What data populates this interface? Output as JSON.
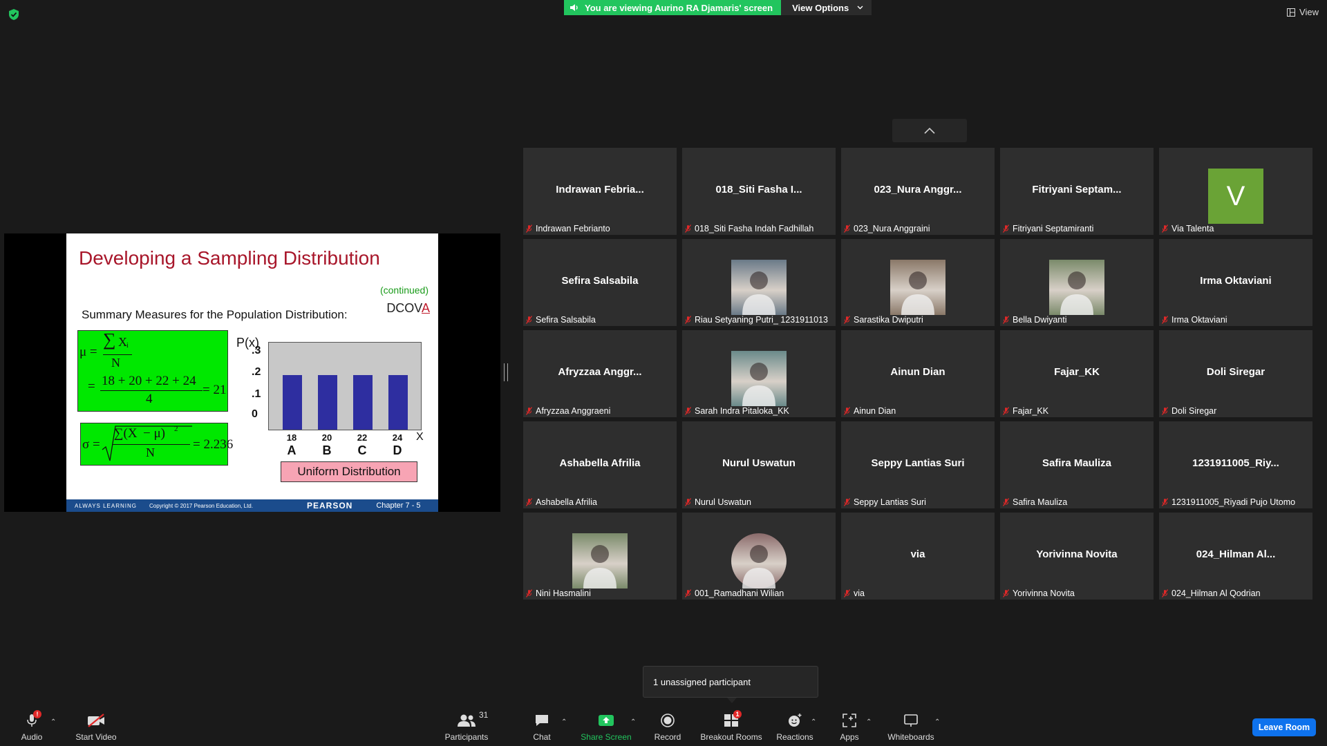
{
  "banner": {
    "viewing_text": "You are viewing Aurino RA Djamaris' screen",
    "view_options": "View Options"
  },
  "view_button": "View",
  "slide": {
    "title": "Developing a Sampling Distribution",
    "continued": "(continued)",
    "dcov": "DCOV",
    "dcova_a": "A",
    "subtitle": "Summary Measures for the Population Distribution:",
    "mu_symbol": "μ =",
    "sum_symbol": "∑",
    "xi": "X",
    "xi_sub": "i",
    "n": "N",
    "mu_expr": "18 + 20 + 22 + 24",
    "eq": "=",
    "mu_den": "4",
    "mu_result": "= 21",
    "sigma_symbol": "σ =",
    "sigma_num": "∑(X",
    "sigma_num_tail": " − μ)",
    "sigma_sq": "2",
    "sigma_result": "= 2.236",
    "px_label": "P(x)",
    "x_label": "X",
    "y_ticks": [
      ".3",
      ".2",
      ".1",
      "0"
    ],
    "x_values": [
      "18",
      "20",
      "22",
      "24"
    ],
    "x_letters": [
      "A",
      "B",
      "C",
      "D"
    ],
    "uniform_label": "Uniform Distribution",
    "footer_always": "ALWAYS LEARNING",
    "footer_copyright": "Copyright © 2017 Pearson Education, Ltd.",
    "footer_pearson": "PEARSON",
    "footer_chapter": "Chapter 7 - 5"
  },
  "chart_data": {
    "type": "bar",
    "categories": [
      "18",
      "20",
      "22",
      "24"
    ],
    "values": [
      0.25,
      0.25,
      0.25,
      0.25
    ],
    "ylabel": "P(x)",
    "xlabel": "X",
    "ylim": [
      0,
      0.4
    ]
  },
  "tiles": [
    {
      "center": "Indrawan  Febria...",
      "footer": "Indrawan Febrianto",
      "kind": "name"
    },
    {
      "center": "018_Siti Fasha I...",
      "footer": "018_Siti Fasha Indah Fadhillah",
      "kind": "name"
    },
    {
      "center": "023_Nura  Anggr...",
      "footer": "023_Nura Anggraini",
      "kind": "name"
    },
    {
      "center": "Fitriyani  Septam...",
      "footer": "Fitriyani Septamiranti",
      "kind": "name"
    },
    {
      "center": "V",
      "footer": "Via Talenta",
      "kind": "letter"
    },
    {
      "center": "Sefira Salsabila",
      "footer": "Sefira Salsabila",
      "kind": "name"
    },
    {
      "center": "",
      "footer": "Riau Setyaning Putri_ 1231911013",
      "kind": "photo"
    },
    {
      "center": "",
      "footer": "Sarastika Dwiputri",
      "kind": "photo"
    },
    {
      "center": "",
      "footer": "Bella Dwiyanti",
      "kind": "photo"
    },
    {
      "center": "Irma Oktaviani",
      "footer": "Irma Oktaviani",
      "kind": "name"
    },
    {
      "center": "Afryzzaa  Anggr...",
      "footer": "Afryzzaa Anggraeni",
      "kind": "name"
    },
    {
      "center": "",
      "footer": "Sarah Indra Pitaloka_KK",
      "kind": "photo"
    },
    {
      "center": "Ainun Dian",
      "footer": "Ainun Dian",
      "kind": "name"
    },
    {
      "center": "Fajar_KK",
      "footer": "Fajar_KK",
      "kind": "name"
    },
    {
      "center": "Doli Siregar",
      "footer": "Doli Siregar",
      "kind": "name"
    },
    {
      "center": "Ashabella Afrilia",
      "footer": "Ashabella Afrilia",
      "kind": "name"
    },
    {
      "center": "Nurul Uswatun",
      "footer": "Nurul Uswatun",
      "kind": "name"
    },
    {
      "center": "Seppy Lantias Suri",
      "footer": "Seppy Lantias Suri",
      "kind": "name"
    },
    {
      "center": "Safira Mauliza",
      "footer": "Safira Mauliza",
      "kind": "name"
    },
    {
      "center": "1231911005_Riy...",
      "footer": "1231911005_Riyadi Pujo Utomo",
      "kind": "name"
    },
    {
      "center": "",
      "footer": "Nini Hasmalini",
      "kind": "photo"
    },
    {
      "center": "",
      "footer": "001_Ramadhani Wilian",
      "kind": "photo"
    },
    {
      "center": "via",
      "footer": "via",
      "kind": "name"
    },
    {
      "center": "Yorivinna Novita",
      "footer": "Yorivinna Novita",
      "kind": "name"
    },
    {
      "center": "024_Hilman  Al...",
      "footer": "024_Hilman Al Qodrian",
      "kind": "name"
    }
  ],
  "toast": "1 unassigned participant",
  "toolbar": {
    "audio": "Audio",
    "audio_badge": "!",
    "start_video": "Start Video",
    "participants": "Participants",
    "participants_count": "31",
    "chat": "Chat",
    "share_screen": "Share Screen",
    "record": "Record",
    "breakout_rooms": "Breakout Rooms",
    "breakout_badge": "1",
    "reactions": "Reactions",
    "apps": "Apps",
    "whiteboards": "Whiteboards",
    "leave_room": "Leave Room"
  },
  "colors": {
    "accent_green": "#22c55e",
    "leave_blue": "#0e72ed",
    "muted_red": "#e02828",
    "slide_title": "#a8162a",
    "avatar_green": "#6aa336"
  }
}
